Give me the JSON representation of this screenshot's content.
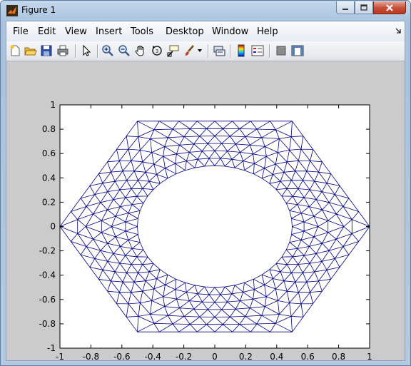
{
  "window": {
    "title": "Figure 1"
  },
  "menu": {
    "items": [
      "File",
      "Edit",
      "View",
      "Insert",
      "Tools",
      "Desktop",
      "Window",
      "Help"
    ]
  },
  "toolbar": {
    "buttons": [
      "new-figure",
      "open-file",
      "save-figure",
      "print-figure",
      "edit-plot",
      "zoom-in",
      "zoom-out",
      "pan",
      "rotate-3d",
      "data-cursor",
      "brush",
      "link-plot",
      "insert-colorbar",
      "insert-legend",
      "hide-plot-tools",
      "show-plot-tools"
    ]
  },
  "plot": {
    "xaxis": {
      "ticks": [
        "-1",
        "-0.8",
        "-0.6",
        "-0.4",
        "-0.2",
        "0",
        "0.2",
        "0.4",
        "0.6",
        "0.8",
        "1"
      ]
    },
    "yaxis": {
      "ticks": [
        "1",
        "0.8",
        "0.6",
        "0.4",
        "0.2",
        "0",
        "-0.2",
        "-0.4",
        "-0.6",
        "-0.8",
        "-1"
      ]
    },
    "mesh_color": "#000080"
  },
  "chart_data": {
    "type": "mesh",
    "xlim": [
      -1,
      1
    ],
    "ylim": [
      -1,
      1
    ],
    "outer_boundary": {
      "shape": "hexagon",
      "vertices": [
        [
          1,
          0
        ],
        [
          0.5,
          0.866
        ],
        [
          -0.5,
          0.866
        ],
        [
          -1,
          0
        ],
        [
          -0.5,
          -0.866
        ],
        [
          0.5,
          -0.866
        ]
      ]
    },
    "inner_boundary": {
      "shape": "ellipse",
      "center": [
        0,
        0
      ],
      "rx": 0.5,
      "ry": 0.5
    },
    "element": "triangle",
    "grid": false
  }
}
